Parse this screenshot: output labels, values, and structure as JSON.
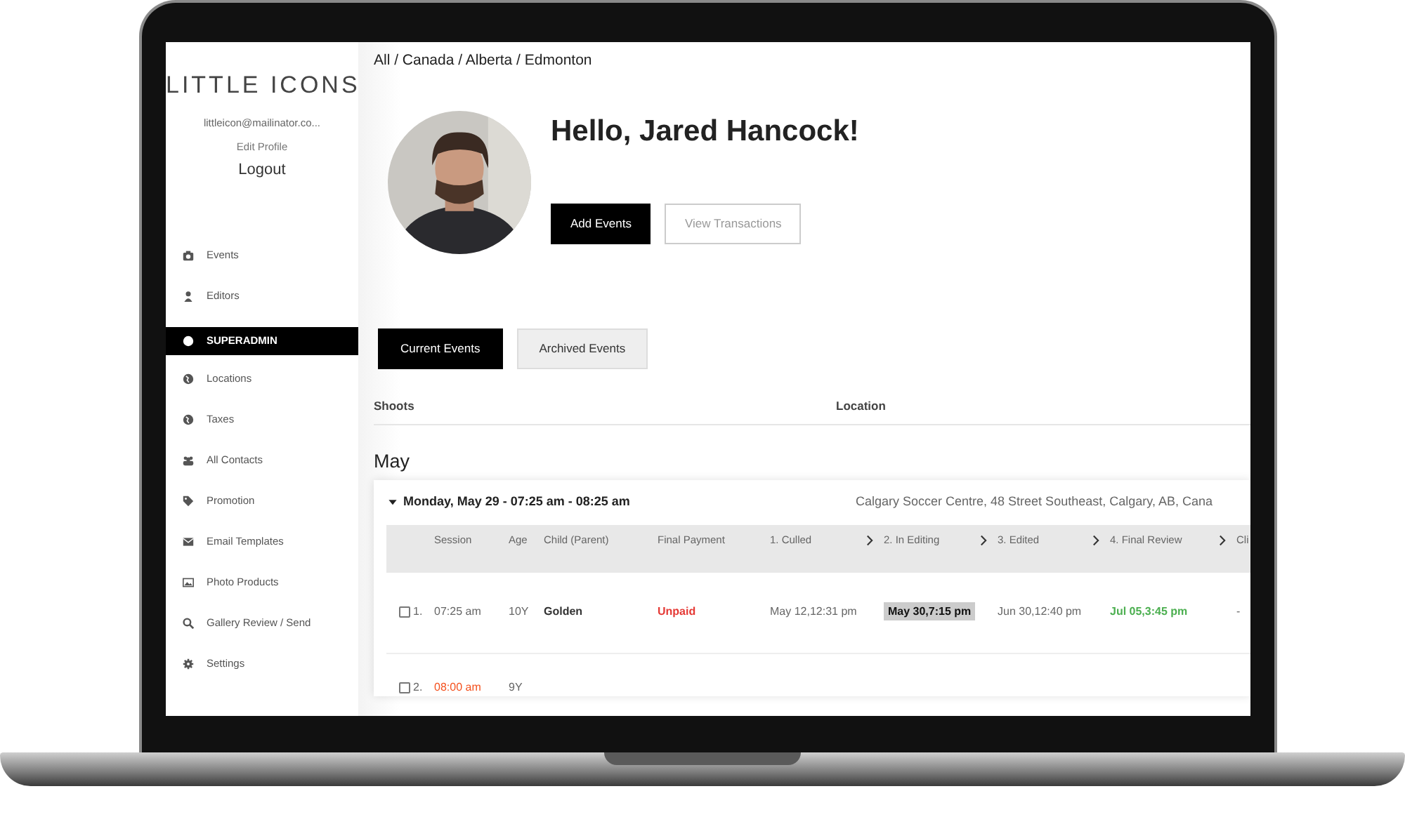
{
  "sidebar": {
    "logo": "LITTLE ICONS",
    "email": "littleicon@mailinator.co...",
    "edit_profile": "Edit Profile",
    "logout": "Logout",
    "items": [
      {
        "kind": "item",
        "label": "Events",
        "selected": false
      },
      {
        "kind": "item",
        "label": "Editors",
        "selected": false
      },
      {
        "kind": "section",
        "label": "SUPERADMIN",
        "selected": true
      },
      {
        "kind": "item",
        "label": "Locations",
        "selected": false
      },
      {
        "kind": "item",
        "label": "Taxes",
        "selected": false
      },
      {
        "kind": "item",
        "label": "All Contacts",
        "selected": false
      },
      {
        "kind": "item",
        "label": "Promotion",
        "selected": false
      },
      {
        "kind": "item",
        "label": "Email Templates",
        "selected": false
      },
      {
        "kind": "item",
        "label": "Photo Products",
        "selected": false
      },
      {
        "kind": "item",
        "label": "Gallery Review / Send",
        "selected": false
      },
      {
        "kind": "item",
        "label": "Settings",
        "selected": false
      }
    ]
  },
  "breadcrumb": "All / Canada / Alberta / Edmonton",
  "greeting": "Hello, Jared Hancock!",
  "buttons": [
    {
      "label": "Add Events",
      "kind": "primary"
    },
    {
      "label": "View Transactions",
      "kind": "outline"
    }
  ],
  "tabs": [
    {
      "label": "Current Events",
      "selected": true
    },
    {
      "label": "Archived Events",
      "selected": false
    }
  ],
  "table": {
    "columns": [
      "Shoots",
      "Location"
    ],
    "month": "May",
    "event": {
      "title": "Monday, May 29 - 07:25 am - 08:25 am",
      "location": "Calgary Soccer Centre, 48 Street Southeast, Calgary, AB, Cana",
      "expanded": true,
      "columns": [
        {
          "label": "Session",
          "stage": false
        },
        {
          "label": "Age",
          "stage": false
        },
        {
          "label": "Child (Parent)",
          "stage": false
        },
        {
          "label": "Final Payment",
          "stage": false
        },
        {
          "label": "1. Culled",
          "stage": true
        },
        {
          "label": "2. In Editing",
          "stage": true
        },
        {
          "label": "3. Edited",
          "stage": true
        },
        {
          "label": "4. Final Review",
          "stage": true
        },
        {
          "label": "Cli",
          "stage": false
        }
      ],
      "rows": [
        {
          "checked": false,
          "number": "1.",
          "time": "07:25 am",
          "time_alert": false,
          "age": "10Y",
          "child": "Golden",
          "payment": "Unpaid",
          "paid": false,
          "stages": [
            {
              "text": "May 12,12:31 pm",
              "highlighted": false,
              "approved": false
            },
            {
              "text": "May 30,7:15 pm",
              "highlighted": true,
              "approved": false
            },
            {
              "text": "Jun 30,12:40 pm",
              "highlighted": false,
              "approved": false
            },
            {
              "text": "Jul 05,3:45 pm",
              "highlighted": false,
              "approved": true
            },
            {
              "text": "-",
              "highlighted": false,
              "approved": false
            }
          ]
        },
        {
          "checked": false,
          "number": "2.",
          "time": "08:00 am",
          "time_alert": true,
          "age": "9Y"
        }
      ]
    }
  }
}
